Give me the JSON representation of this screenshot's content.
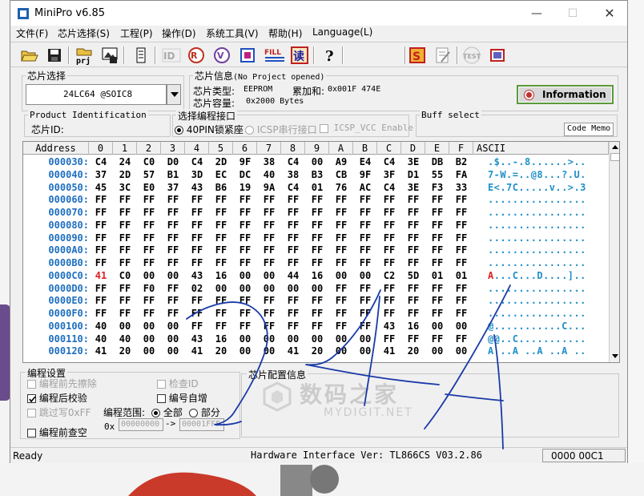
{
  "title": "MiniPro v6.85",
  "menu": [
    "文件(F)",
    "芯片选择(S)",
    "工程(P)",
    "操作(D)",
    "系统工具(V)",
    "帮助(H)",
    "Language(L)"
  ],
  "toolbar_icons": [
    "open-icon",
    "save-icon",
    "project-icon",
    "save-project-icon",
    "chip-info-icon",
    "read-id-icon",
    "read-icon",
    "verify-icon",
    "program-icon",
    "fill-icon",
    "erase-check-icon",
    "help-icon",
    "chip-test-icon",
    "edit-icon",
    "test-icon",
    "logic-test-icon"
  ],
  "toolbar_labels": {
    "prj": "prj",
    "fill": "FILL",
    "test": "TEST"
  },
  "chip_select": {
    "label": "芯片选择",
    "value": "24LC64 @SOIC8"
  },
  "chip_info": {
    "label": "芯片信息",
    "project_status": "(No Project opened)",
    "type_label": "芯片类型:",
    "type_value": "EEPROM",
    "checksum_label": "累加和:",
    "checksum_value": "0x001F 474E",
    "capacity_label": "芯片容量:",
    "capacity_value": "0x2000 Bytes",
    "information_button": "Information"
  },
  "product_id": {
    "label": "Product Identification",
    "chip_id_label": "芯片ID:"
  },
  "prog_interface": {
    "label": "选择编程接口",
    "opt1": "40PIN锁紧座",
    "opt2": "ICSP串行接口",
    "opt3": "ICSP_VCC Enable"
  },
  "buff_select": {
    "label": "Buff select",
    "code_memo": "Code Memo"
  },
  "hex": {
    "header": {
      "address": "Address",
      "cols": [
        "0",
        "1",
        "2",
        "3",
        "4",
        "5",
        "6",
        "7",
        "8",
        "9",
        "A",
        "B",
        "C",
        "D",
        "E",
        "F"
      ],
      "ascii": "ASCII"
    },
    "rows": [
      {
        "addr": "000030:",
        "bytes": [
          "C4",
          "24",
          "C0",
          "D0",
          "C4",
          "2D",
          "9F",
          "38",
          "C4",
          "00",
          "A9",
          "E4",
          "C4",
          "3E",
          "DB",
          "B2"
        ],
        "ascii": ".$..-.8......>.."
      },
      {
        "addr": "000040:",
        "bytes": [
          "37",
          "2D",
          "57",
          "B1",
          "3D",
          "EC",
          "DC",
          "40",
          "38",
          "B3",
          "CB",
          "9F",
          "3F",
          "D1",
          "55",
          "FA"
        ],
        "ascii": "7-W.=..@8...?.U."
      },
      {
        "addr": "000050:",
        "bytes": [
          "45",
          "3C",
          "E0",
          "37",
          "43",
          "B6",
          "19",
          "9A",
          "C4",
          "01",
          "76",
          "AC",
          "C4",
          "3E",
          "F3",
          "33"
        ],
        "ascii": "E<.7C.....v..>.3"
      },
      {
        "addr": "000060:",
        "bytes": [
          "FF",
          "FF",
          "FF",
          "FF",
          "FF",
          "FF",
          "FF",
          "FF",
          "FF",
          "FF",
          "FF",
          "FF",
          "FF",
          "FF",
          "FF",
          "FF"
        ],
        "ascii": "................"
      },
      {
        "addr": "000070:",
        "bytes": [
          "FF",
          "FF",
          "FF",
          "FF",
          "FF",
          "FF",
          "FF",
          "FF",
          "FF",
          "FF",
          "FF",
          "FF",
          "FF",
          "FF",
          "FF",
          "FF"
        ],
        "ascii": "................"
      },
      {
        "addr": "000080:",
        "bytes": [
          "FF",
          "FF",
          "FF",
          "FF",
          "FF",
          "FF",
          "FF",
          "FF",
          "FF",
          "FF",
          "FF",
          "FF",
          "FF",
          "FF",
          "FF",
          "FF"
        ],
        "ascii": "................"
      },
      {
        "addr": "000090:",
        "bytes": [
          "FF",
          "FF",
          "FF",
          "FF",
          "FF",
          "FF",
          "FF",
          "FF",
          "FF",
          "FF",
          "FF",
          "FF",
          "FF",
          "FF",
          "FF",
          "FF"
        ],
        "ascii": "................"
      },
      {
        "addr": "0000A0:",
        "bytes": [
          "FF",
          "FF",
          "FF",
          "FF",
          "FF",
          "FF",
          "FF",
          "FF",
          "FF",
          "FF",
          "FF",
          "FF",
          "FF",
          "FF",
          "FF",
          "FF"
        ],
        "ascii": "................"
      },
      {
        "addr": "0000B0:",
        "bytes": [
          "FF",
          "FF",
          "FF",
          "FF",
          "FF",
          "FF",
          "FF",
          "FF",
          "FF",
          "FF",
          "FF",
          "FF",
          "FF",
          "FF",
          "FF",
          "FF"
        ],
        "ascii": "................"
      },
      {
        "addr": "0000C0:",
        "bytes": [
          "41",
          "C0",
          "00",
          "00",
          "43",
          "16",
          "00",
          "00",
          "44",
          "16",
          "00",
          "00",
          "C2",
          "5D",
          "01",
          "01"
        ],
        "ascii": "A...C...D....]..",
        "first_red": true
      },
      {
        "addr": "0000D0:",
        "bytes": [
          "FF",
          "FF",
          "F0",
          "FF",
          "02",
          "00",
          "00",
          "00",
          "00",
          "00",
          "FF",
          "FF",
          "FF",
          "FF",
          "FF",
          "FF"
        ],
        "ascii": "................"
      },
      {
        "addr": "0000E0:",
        "bytes": [
          "FF",
          "FF",
          "FF",
          "FF",
          "FF",
          "FF",
          "FF",
          "FF",
          "FF",
          "FF",
          "FF",
          "FF",
          "FF",
          "FF",
          "FF",
          "FF"
        ],
        "ascii": "................"
      },
      {
        "addr": "0000F0:",
        "bytes": [
          "FF",
          "FF",
          "FF",
          "FF",
          "FF",
          "FF",
          "FF",
          "FF",
          "FF",
          "FF",
          "FF",
          "FF",
          "FF",
          "FF",
          "FF",
          "FF"
        ],
        "ascii": "................"
      },
      {
        "addr": "000100:",
        "bytes": [
          "40",
          "00",
          "00",
          "00",
          "FF",
          "FF",
          "FF",
          "FF",
          "FF",
          "FF",
          "FF",
          "FF",
          "43",
          "16",
          "00",
          "00"
        ],
        "ascii": "@...........C..."
      },
      {
        "addr": "000110:",
        "bytes": [
          "40",
          "40",
          "00",
          "00",
          "43",
          "16",
          "00",
          "00",
          "00",
          "00",
          "00",
          "00",
          "FF",
          "FF",
          "FF",
          "FF"
        ],
        "ascii": "@@..C..........."
      },
      {
        "addr": "000120:",
        "bytes": [
          "41",
          "20",
          "00",
          "00",
          "41",
          "20",
          "00",
          "00",
          "41",
          "20",
          "00",
          "00",
          "41",
          "20",
          "00",
          "00"
        ],
        "ascii": "A ..A ..A ..A .."
      }
    ]
  },
  "prog_settings": {
    "label": "编程设置",
    "opt_blank": "编程前先擦除",
    "opt_verify": "编程后校验",
    "opt_skip": "跳过写0xFF",
    "opt_blankcheck": "编程前查空",
    "opt_check_id": "检查ID",
    "opt_autoinc": "编号自增",
    "range_label": "编程范围:",
    "range_all": "全部",
    "range_part": "部分",
    "range_prefix": "0x",
    "range_start": "00000000",
    "range_arrow": "->",
    "range_end": "00001FFF"
  },
  "config": {
    "label": "芯片配置信息"
  },
  "watermark": {
    "main": "数码之家",
    "sub": "MYDIGIT.NET"
  },
  "status": {
    "left": "Ready",
    "middle": "Hardware Interface Ver: TL866CS V03.2.86",
    "right": "0000 00C1"
  }
}
